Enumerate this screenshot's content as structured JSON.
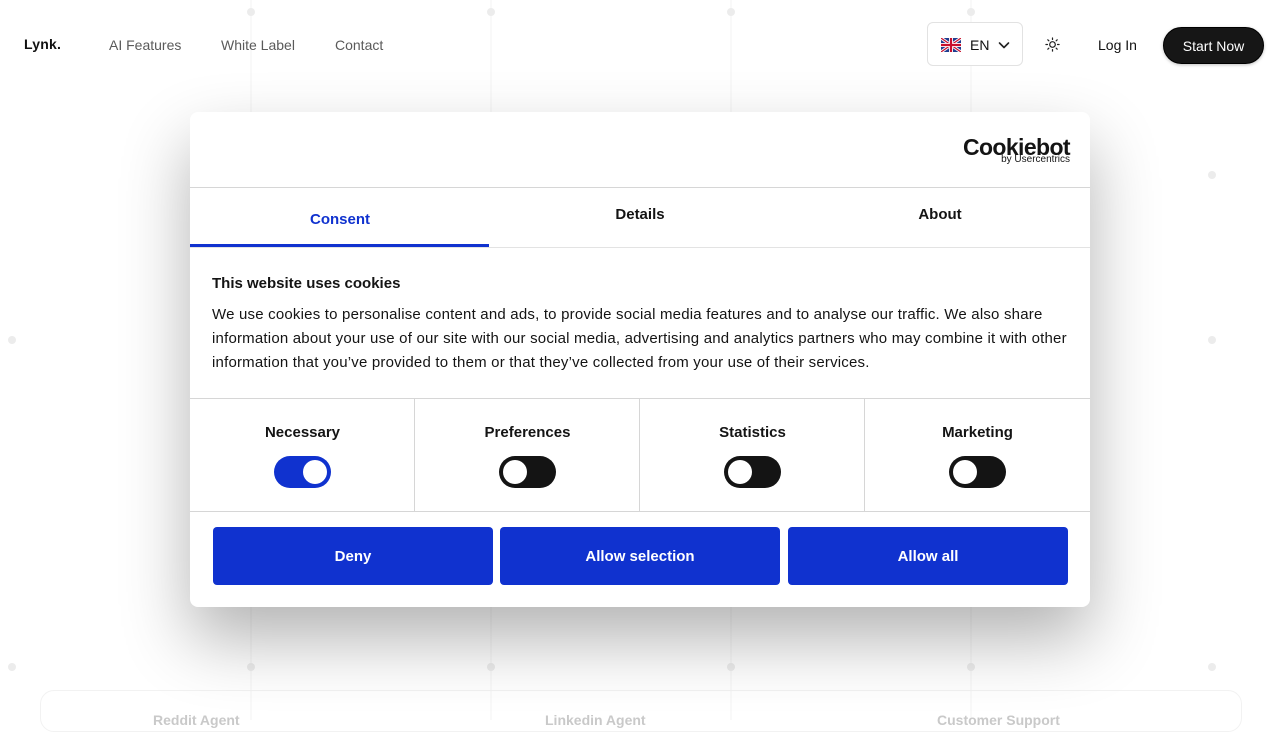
{
  "header": {
    "logo": "Lynk.",
    "nav": [
      "AI Features",
      "White Label",
      "Contact"
    ],
    "language": {
      "flag": "uk-flag-icon",
      "code": "EN"
    },
    "theme_icon": "sun-icon",
    "login": "Log In",
    "cta": "Start Now"
  },
  "background": {
    "cards": [
      "Reddit Agent",
      "Linkedin Agent",
      "Customer Support"
    ]
  },
  "cookie_dialog": {
    "brand": {
      "name": "Cookiebot",
      "sub": "by Usercentrics"
    },
    "tabs": [
      {
        "label": "Consent",
        "active": true
      },
      {
        "label": "Details",
        "active": false
      },
      {
        "label": "About",
        "active": false
      }
    ],
    "title": "This website uses cookies",
    "body": "We use cookies to personalise content and ads, to provide social media features and to analyse our traffic. We also share information about your use of our site with our social media, advertising and analytics partners who may combine it with other information that you’ve provided to them or that they’ve collected from your use of their services.",
    "categories": [
      {
        "label": "Necessary",
        "enabled": true
      },
      {
        "label": "Preferences",
        "enabled": false
      },
      {
        "label": "Statistics",
        "enabled": false
      },
      {
        "label": "Marketing",
        "enabled": false
      }
    ],
    "buttons": {
      "deny": "Deny",
      "allow_selection": "Allow selection",
      "allow_all": "Allow all"
    },
    "colors": {
      "accent": "#1032cf",
      "toggle_off": "#141414"
    }
  }
}
